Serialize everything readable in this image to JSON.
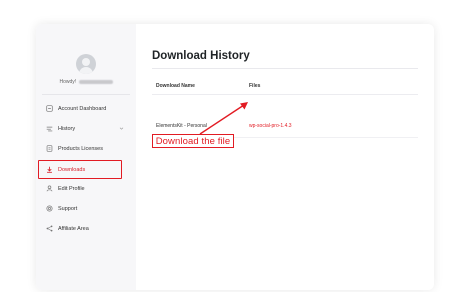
{
  "sidebar": {
    "greeting": "Howdy!",
    "items": [
      {
        "label": "Account Dashboard",
        "icon": "dashboard-icon"
      },
      {
        "label": "History",
        "icon": "history-icon",
        "has_chevron": true
      },
      {
        "label": "Products Licenses",
        "icon": "license-icon"
      },
      {
        "label": "Downloads",
        "icon": "download-icon",
        "active": true
      },
      {
        "label": "Edit Profile",
        "icon": "user-icon"
      },
      {
        "label": "Support",
        "icon": "support-icon"
      },
      {
        "label": "Affiliate Area",
        "icon": "share-icon"
      }
    ]
  },
  "main": {
    "title": "Download History",
    "table": {
      "headers": [
        "Download Name",
        "Files"
      ],
      "rows": [
        {
          "name": "ElementsKit - Personal",
          "file": "wp-social-pro-1.4.3"
        }
      ]
    }
  },
  "annotation": {
    "label": "Download the file"
  },
  "colors": {
    "accent": "#e21b23",
    "sidebar_bg": "#f7f7f9",
    "text": "#333333"
  }
}
